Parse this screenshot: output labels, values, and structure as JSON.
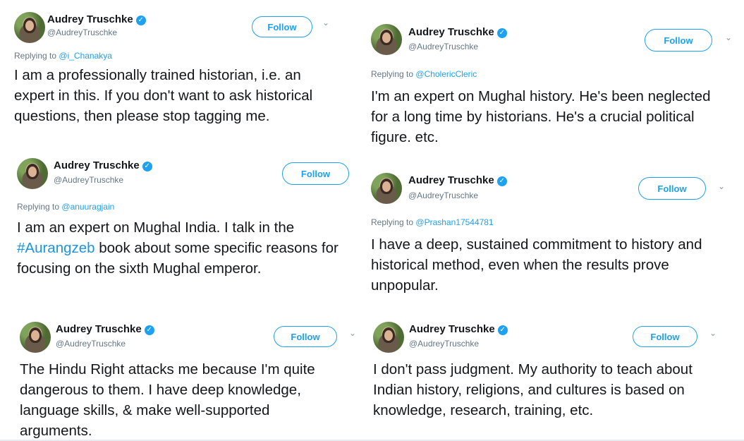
{
  "author": {
    "name": "Audrey Truschke",
    "handle": "@AudreyTruschke",
    "verified_glyph": "✓"
  },
  "follow_label": "Follow",
  "caret_glyph": "⌄",
  "reply_prefix": "Replying to",
  "tweets": [
    {
      "reply_to": "@i_Chanakya",
      "text": "I am a professionally trained historian, i.e. an expert in this. If you don't want to ask historical questions, then please stop tagging me."
    },
    {
      "reply_to": "@anuuragjain",
      "text_before": "I am an expert on Mughal India. I talk in the ",
      "hashtag": "#Aurangzeb",
      "text_after": " book about some specific reasons for focusing on the sixth Mughal emperor."
    },
    {
      "text": "The Hindu Right attacks me because I'm quite dangerous to them. I have deep knowledge, language skills, & make well-supported arguments."
    },
    {
      "reply_to": "@CholericCleric",
      "text": "I'm an expert on Mughal history. He's been neglected for a long time by historians. He's a crucial political figure. etc."
    },
    {
      "reply_to": "@Prashan17544781",
      "text": "I have a deep, sustained commitment to history and historical method, even when the results prove unpopular."
    },
    {
      "text": "I don't pass judgment. My authority to teach about Indian history, religions, and cultures is based on knowledge, research, training, etc."
    }
  ],
  "colors": {
    "accent": "#1da1f2",
    "text": "#14171a",
    "muted": "#657786"
  }
}
